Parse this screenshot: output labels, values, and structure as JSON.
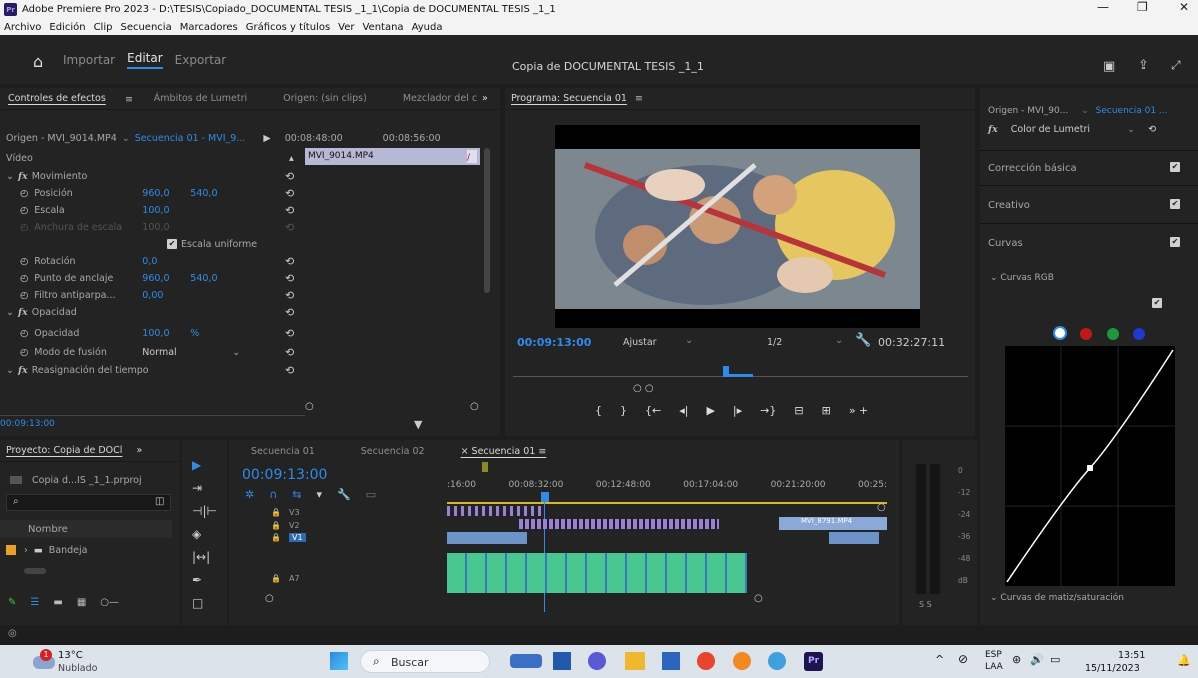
{
  "window": {
    "title": "Adobe Premiere Pro 2023 - D:\\TESIS\\Copiado_DOCUMENTAL TESIS _1_1\\Copia de DOCUMENTAL TESIS _1_1",
    "app_icon": "Pr"
  },
  "menu": [
    "Archivo",
    "Edición",
    "Clip",
    "Secuencia",
    "Marcadores",
    "Gráficos y títulos",
    "Ver",
    "Ventana",
    "Ayuda"
  ],
  "workspaces": [
    "Importar",
    "Editar",
    "Exportar"
  ],
  "project_title": "Copia de DOCUMENTAL TESIS _1_1",
  "effects_panel": {
    "tabs": [
      "Controles de efectos",
      "Ámbitos de Lumetri",
      "Origen: (sin clips)",
      "Mezclador del c"
    ],
    "source": "Origen - MVI_9014.MP4",
    "sequence": "Secuencia 01 - MVI_9...",
    "tc_start": "00:08:48:00",
    "tc_end": "00:08:56:00",
    "clip": "MVI_9014.MP4",
    "section_video": "Vídeo",
    "rows": [
      {
        "label": "Movimiento",
        "fx": true
      },
      {
        "label": "Posición",
        "v1": "960,0",
        "v2": "540,0"
      },
      {
        "label": "Escala",
        "v1": "100,0"
      },
      {
        "label": "Anchura de escala",
        "v1": "100,0",
        "disabled": true
      },
      {
        "label": "Escala uniforme",
        "checkbox": true
      },
      {
        "label": "Rotación",
        "v1": "0,0"
      },
      {
        "label": "Punto de anclaje",
        "v1": "960,0",
        "v2": "540,0"
      },
      {
        "label": "Filtro antiparpa...",
        "v1": "0,00"
      },
      {
        "label": "Opacidad",
        "fx": true
      },
      {
        "label": "Opacidad",
        "v1": "100,0",
        "v2": "%"
      },
      {
        "label": "Modo de fusión",
        "select": "Normal"
      },
      {
        "label": "Reasignación del tiempo",
        "fx": true
      }
    ],
    "timecode": "00:09:13:00"
  },
  "program": {
    "tab": "Programa: Secuencia 01",
    "timecode": "00:09:13:00",
    "fit": "Ajustar",
    "quality": "1/2",
    "duration": "00:32:27:11"
  },
  "lumetri": {
    "source": "Origen - MVI_90...",
    "sequence": "Secuencia 01 ...",
    "effect": "Color de Lumetri",
    "sections": [
      "Corrección básica",
      "Creativo",
      "Curvas"
    ],
    "curves_rgb": "Curvas RGB",
    "hue_sat": "Curvas de matiz/saturación"
  },
  "project": {
    "tab": "Proyecto: Copia de DOCl",
    "file": "Copia d...IS _1_1.prproj",
    "col_name": "Nombre",
    "bin": "Bandeja"
  },
  "timeline": {
    "tabs": [
      "Secuencia 01",
      "Secuencia 02",
      "Secuencia 01"
    ],
    "timecode": "00:09:13:00",
    "ruler": [
      ":16:00",
      "00:08:32:00",
      "00:12:48:00",
      "00:17:04:00",
      "00:21:20:00",
      "00:25:"
    ],
    "tracks": [
      "V3",
      "V2",
      "V1",
      "A7"
    ],
    "clip_label": "MVI_8791.MP4",
    "meter": [
      "0",
      "-12",
      "-24",
      "-36",
      "-48",
      "dB"
    ],
    "ss": "S  S"
  },
  "taskbar": {
    "temp": "13°C",
    "weather": "Nublado",
    "badge": "1",
    "search": "Buscar",
    "lang1": "ESP",
    "lang2": "LAA",
    "time": "13:51",
    "date": "15/11/2023"
  }
}
